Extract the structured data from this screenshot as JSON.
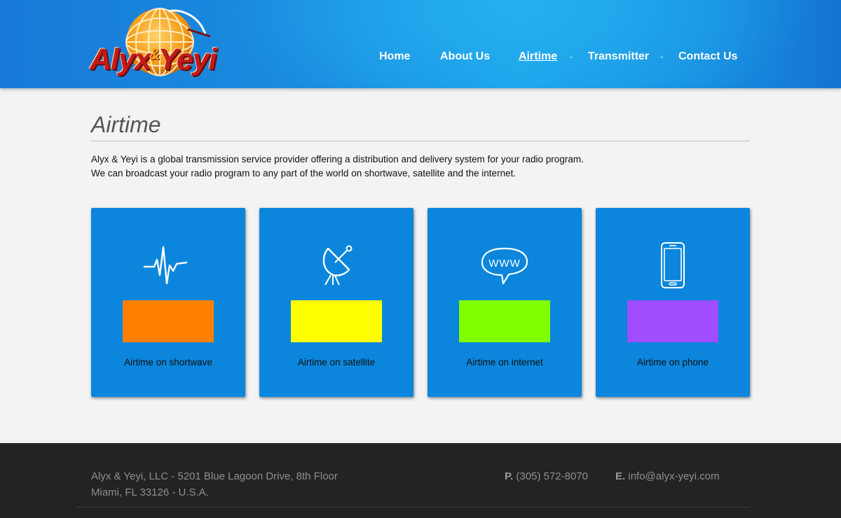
{
  "brand": {
    "logo_text": "Alyx",
    "logo_amp": "&",
    "logo_text2": "Yeyi"
  },
  "nav": {
    "items": [
      {
        "label": "Home"
      },
      {
        "label": "About Us"
      },
      {
        "label": "Airtime",
        "active": true,
        "has_dropdown": true
      },
      {
        "label": "Transmitter",
        "has_dropdown": true
      },
      {
        "label": "Contact Us"
      }
    ]
  },
  "page": {
    "title": "Airtime",
    "intro_line1": "Alyx & Yeyi is a global transmission service provider offering a distribution and delivery system for your radio program.",
    "intro_line2": "We can broadcast your radio program to any part of the world on shortwave, satellite and the internet."
  },
  "cards": [
    {
      "label": "Airtime on shortwave",
      "icon": "shortwave-signal-icon",
      "swatch_color": "#ff8000"
    },
    {
      "label": "Airtime on satellite",
      "icon": "satellite-dish-icon",
      "swatch_color": "#ffff00"
    },
    {
      "label": "Airtime on internet",
      "icon": "www-speech-bubble-icon",
      "swatch_color": "#80ff00"
    },
    {
      "label": "Airtime on phone",
      "icon": "smartphone-icon",
      "swatch_color": "#a04cff"
    }
  ],
  "footer": {
    "address_line1": "Alyx & Yeyi, LLC - 5201 Blue Lagoon Drive, 8th Floor",
    "address_line2": "Miami, FL 33126 - U.S.A.",
    "phone_prefix": "P.",
    "phone": "(305) 572-8070",
    "email_prefix": "E.",
    "email": "info@alyx-yeyi.com"
  },
  "colors": {
    "header_blue": "#1a8fe0",
    "card_blue": "#0b86dc",
    "footer_bg": "#232325"
  }
}
